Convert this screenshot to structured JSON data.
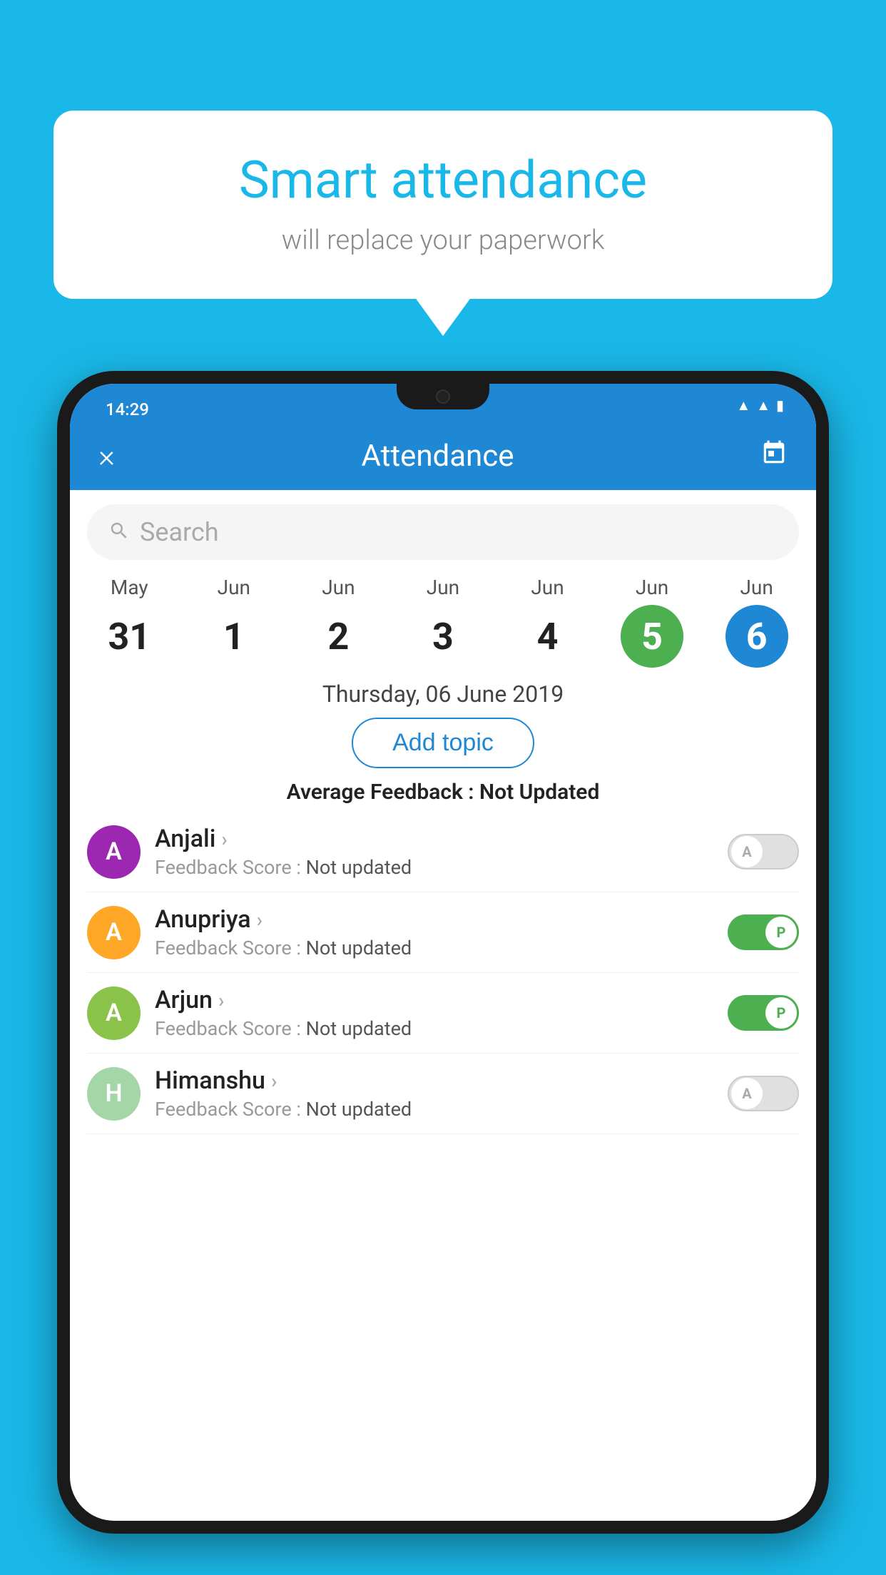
{
  "background_color": "#1ab8e8",
  "speech_bubble": {
    "title": "Smart attendance",
    "subtitle": "will replace your paperwork"
  },
  "status_bar": {
    "time": "14:29",
    "icons": [
      "wifi",
      "signal",
      "battery"
    ]
  },
  "app_header": {
    "title": "Attendance",
    "close_label": "×",
    "calendar_icon": "📅"
  },
  "search": {
    "placeholder": "Search"
  },
  "calendar": {
    "days": [
      {
        "month": "May",
        "day": "31",
        "state": "normal"
      },
      {
        "month": "Jun",
        "day": "1",
        "state": "normal"
      },
      {
        "month": "Jun",
        "day": "2",
        "state": "normal"
      },
      {
        "month": "Jun",
        "day": "3",
        "state": "normal"
      },
      {
        "month": "Jun",
        "day": "4",
        "state": "normal"
      },
      {
        "month": "Jun",
        "day": "5",
        "state": "today"
      },
      {
        "month": "Jun",
        "day": "6",
        "state": "selected"
      }
    ]
  },
  "selected_date": "Thursday, 06 June 2019",
  "add_topic_label": "Add topic",
  "avg_feedback_label": "Average Feedback :",
  "avg_feedback_value": "Not Updated",
  "students": [
    {
      "name": "Anjali",
      "avatar_letter": "A",
      "avatar_color": "#9c27b0",
      "feedback_label": "Feedback Score :",
      "feedback_value": "Not updated",
      "toggle_state": "off",
      "toggle_letter": "A"
    },
    {
      "name": "Anupriya",
      "avatar_letter": "A",
      "avatar_color": "#ffa726",
      "feedback_label": "Feedback Score :",
      "feedback_value": "Not updated",
      "toggle_state": "on",
      "toggle_letter": "P"
    },
    {
      "name": "Arjun",
      "avatar_letter": "A",
      "avatar_color": "#8bc34a",
      "feedback_label": "Feedback Score :",
      "feedback_value": "Not updated",
      "toggle_state": "on",
      "toggle_letter": "P"
    },
    {
      "name": "Himanshu",
      "avatar_letter": "H",
      "avatar_color": "#a5d6a7",
      "feedback_label": "Feedback Score :",
      "feedback_value": "Not updated",
      "toggle_state": "off",
      "toggle_letter": "A"
    }
  ]
}
